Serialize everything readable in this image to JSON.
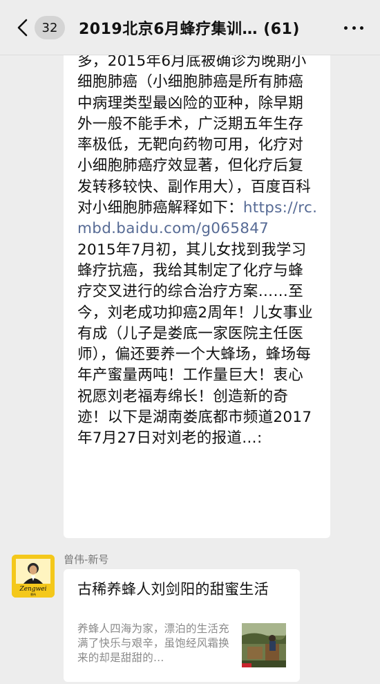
{
  "header": {
    "unread_count": "32",
    "title": "2019北京6月蜂疗集训… (61)"
  },
  "message": {
    "paragraph_1": "多，2015年6月底被确诊为晚期小细胞肺癌（小细胞肺癌是所有肺癌中病理类型最凶险的亚种，除早期外一般不能手术，广泛期五年生存率极低，无靶向药物可用，化疗对小细胞肺癌疗效显著，但化疗后复发转移较快、副作用大），百度百科对小细胞肺癌解释如下：",
    "link": "https://rc.mbd.baidu.com/g065847",
    "paragraph_2": "2015年7月初，其儿女找到我学习蜂疗抗癌，我给其制定了化疗与蜂疗交叉进行的综合治疗方案……至今，刘老成功抑癌2周年！儿女事业有成（儿子是娄底一家医院主任医师），偏还要养一个大蜂场，蜂场每年产蜜量两吨！工作量巨大！衷心祝愿刘老福寿绵长！创造新的奇迹！以下是湖南娄底都市频道2017年7月27日对刘老的报道…:"
  },
  "sender": {
    "name": "曾伟-新号",
    "avatar_text": "Zengwei",
    "avatar_subtext": "曾伟"
  },
  "article_card": {
    "title": "古稀养蜂人刘剑阳的甜蜜生活",
    "description": "养蜂人四海为家，漂泊的生活充满了快乐与艰辛，虽饱经风霜换来的却是甜甜的…"
  }
}
